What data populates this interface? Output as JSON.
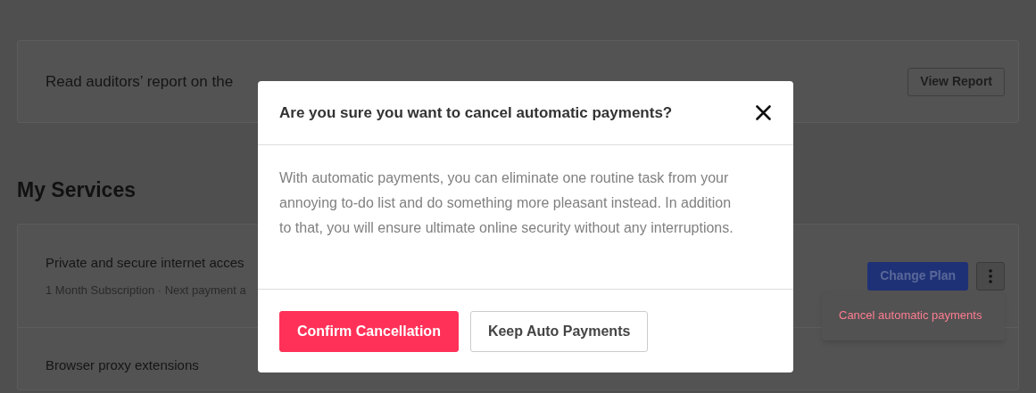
{
  "page": {
    "report_card": {
      "text": "Read auditors’ report on the",
      "button": "View Report"
    },
    "section_title": "My Services",
    "services": [
      {
        "title": "Private and secure internet acces",
        "subtitle": "1 Month Subscription · Next payment a",
        "button": "Change Plan",
        "menu_open": true
      },
      {
        "title": "Browser proxy extensions"
      }
    ],
    "menu": {
      "items": [
        "Cancel automatic payments"
      ]
    }
  },
  "dialog": {
    "title": "Are you sure you want to cancel automatic payments?",
    "body": "With automatic payments, you can eliminate one routine task from your annoying to-do list and do something more pleasant instead. In addition to that, you will ensure ultimate online security without any interruptions.",
    "buttons": [
      {
        "label": "Confirm Cancellation",
        "kind": "primary"
      },
      {
        "label": "Keep Auto Payments",
        "kind": "secondary"
      }
    ]
  }
}
